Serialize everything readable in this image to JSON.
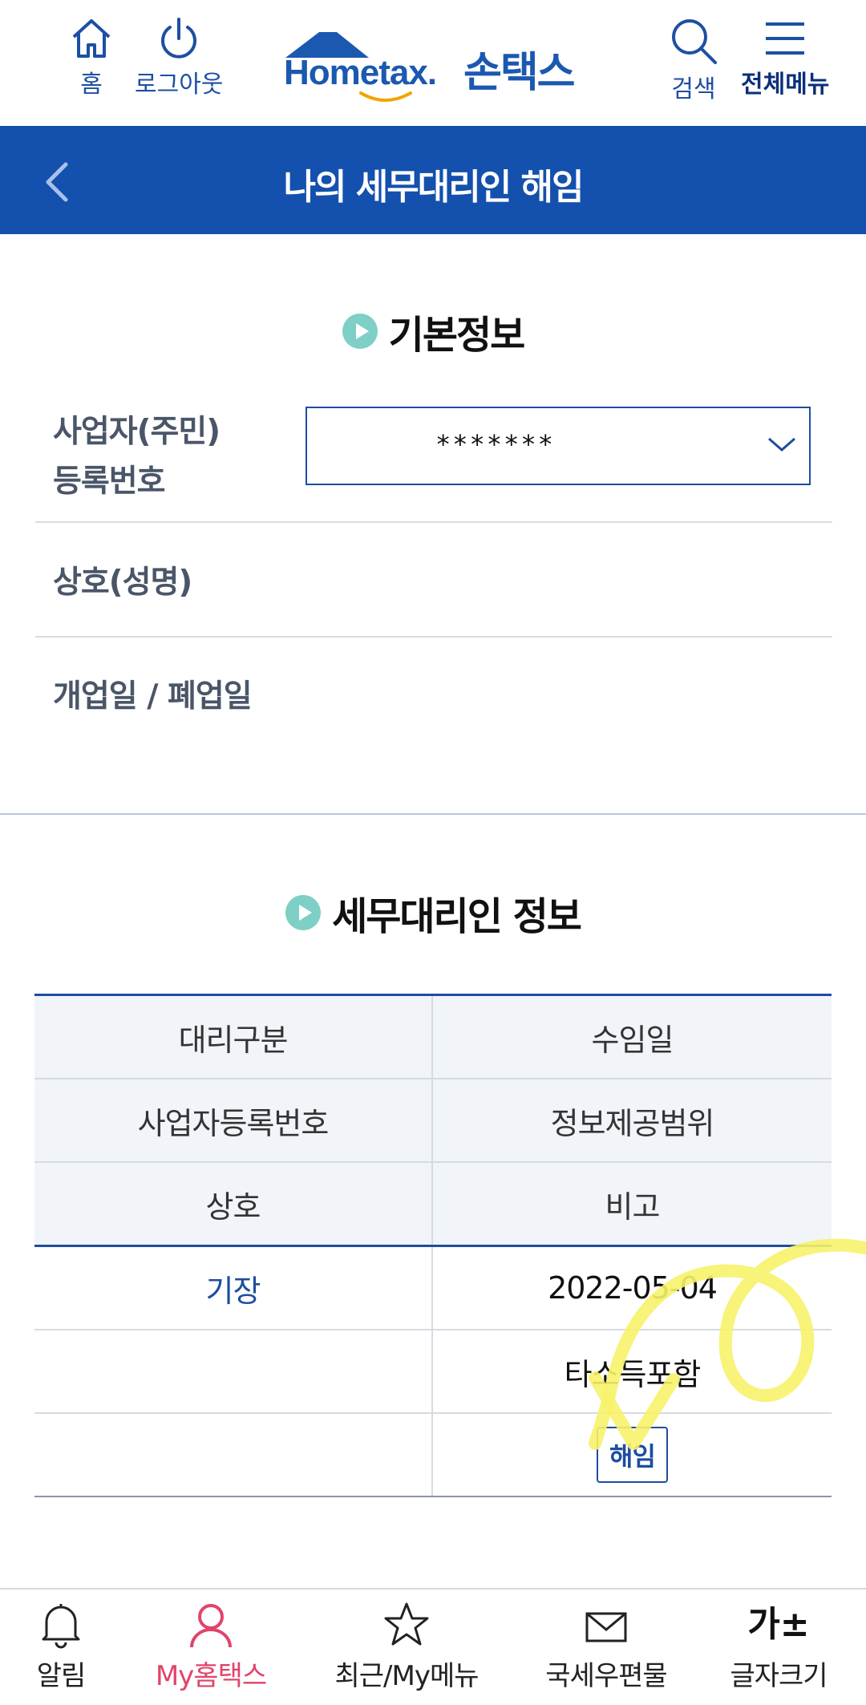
{
  "header": {
    "home_label": "홈",
    "logout_label": "로그아웃",
    "logo_en": "Hometax.",
    "logo_ko": "손택스",
    "search_label": "검색",
    "menu_label": "전체메뉴"
  },
  "title_bar": {
    "title": "나의 세무대리인 해임"
  },
  "basic_info": {
    "heading": "기본정보",
    "reg_no_label_line1": "사업자(주민)",
    "reg_no_label_line2": "등록번호",
    "reg_no_value": "*******",
    "company_label": "상호(성명)",
    "open_close_label": "개업일 / 폐업일"
  },
  "agent_info": {
    "heading": "세무대리인 정보",
    "table_headers": [
      [
        "대리구분",
        "수임일"
      ],
      [
        "사업자등록번호",
        "정보제공범위"
      ],
      [
        "상호",
        "비고"
      ]
    ],
    "rows": {
      "agent_type": "기장",
      "appointed_date": "2022-05-04",
      "info_scope": "타소득포함",
      "dismiss_button": "해임"
    }
  },
  "bottom_nav": {
    "items": [
      {
        "label": "알림"
      },
      {
        "label": "My홈택스"
      },
      {
        "label": "최근/My메뉴"
      },
      {
        "label": "국세우편물"
      },
      {
        "label": "글자크기",
        "glyph": "가±"
      }
    ]
  },
  "colors": {
    "primary_blue": "#1450ad",
    "accent_pink": "#e0446a",
    "bullet_teal": "#7ecfc6",
    "annotation_yellow": "#f7f26a"
  }
}
